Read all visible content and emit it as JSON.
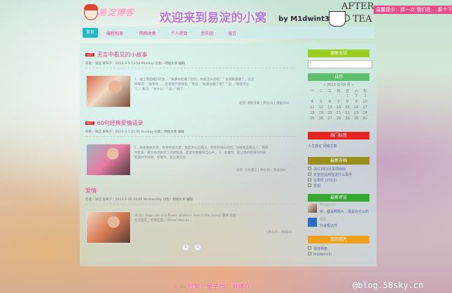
{
  "header": {
    "logo_text": "易淀博客",
    "site_title": "欢迎来到易淀的小窝",
    "site_author": "by M1dwint3r",
    "tea_top": "AFTER",
    "tea_bottom": "TEA",
    "marquee": "温馨提示：那一次 我们在… 那个下雨"
  },
  "nav": [
    {
      "label": "首页",
      "active": true
    },
    {
      "label": "编程相册"
    },
    {
      "label": "网络收集"
    },
    {
      "label": "个人项目"
    },
    {
      "label": "音乐园"
    },
    {
      "label": "留言"
    }
  ],
  "posts": [
    {
      "hot_label": "HOT",
      "title": "无言中看见的小故事",
      "meta": "作者：易淀 发布于：2013-3-9 13:54 Monday 分类：网络文章 编辑",
      "excerpt_line1": "1、碰上熟面相识的女... “如果你想看了他们，你会怎么办呢？” 女孩跟我聊了，说出",
      "excerpt_line2": "哪哪说：“如果你……后来我不想想说，” 我说：“如果你看了嗯？” 说：“那就可以",
      "excerpt_line3": "了。” 我问：“为什么？” 说：“嘛下...",
      "tags": "标签: 网络文章 | 评论(0) | 阅读(93)"
    },
    {
      "hot_label": "HOT",
      "title": "60句经典爱情语录",
      "meta": "作者：易淀 发布于：2013-3-1 21:01 Sunday 分类：网络文章 编辑",
      "excerpt_line1": "1、如果我离开你，你要很想念我，我是你以前遇过，所有的快乐的回，如果我是路过人，我要",
      "excerpt_line2": "你是爱，我为你把微笑了得相思满，就是你整着每当心中。         2、爱着你，就让我把寂寞的时候",
      "excerpt_line3": "有我并不好想，有着你，就让我在你...",
      "tags": "标签: 人生感言 | 评论(0) | 阅读(48)"
    },
    {
      "hot_label": "",
      "title": "爱情",
      "meta": "作者：易淀 发布于：2013-2-20 23:06 Wednesday 分类：网络文章 编辑",
      "excerpt_line1": "Victor Hugo        Life is a flower of which love is the honey.          雨果 雨果",
      "excerpt_line2": "生活是花，爱情是蜜。         Oliver Wende...",
      "excerpt_line3": "",
      "tags": "| 评论(0) | 阅读(0)"
    }
  ],
  "pager": [
    "1",
    "2"
  ],
  "sidebar": {
    "search_title": "搜索全站",
    "search_placeholder": "",
    "calendar_title": "日历",
    "calendar_header": "« 2013 年 03 月 »",
    "weekdays": [
      "一",
      "二",
      "三",
      "四",
      "五",
      "六",
      "日"
    ],
    "weeks": [
      [
        "",
        "",
        "",
        "",
        "1",
        "2",
        "3"
      ],
      [
        "4",
        "5",
        "6",
        "7",
        "8",
        "9",
        "10"
      ],
      [
        "11",
        "12",
        "13",
        "14",
        "15",
        "16",
        "17"
      ],
      [
        "18",
        "19",
        "20",
        "21",
        "22",
        "23",
        "24"
      ],
      [
        "25",
        "26",
        "27",
        "28",
        "29",
        "30",
        "31"
      ]
    ],
    "tags_title": "热门标签",
    "tags_text": "人生感言  网络文章",
    "archive_title": "最新存档",
    "archive": [
      "2013年3月事项存档",
      "无空还没到我说什么事件",
      "在零阶 (2013)",
      "爱情"
    ],
    "comments_title": "最新评论",
    "comments": [
      {
        "name": "M1dwint3r",
        "text": "哈，都是啊照片，很喜欢什么的"
      },
      {
        "name": "易淀",
        "text": "你说呢这样"
      }
    ],
    "links_title": "我的照片",
    "links": [
      "易淀相册",
      "M1dwint3r"
    ]
  },
  "footer": {
    "text": "短暂：是子怡，尹娜介",
    "small": "© 2013",
    "url": "@blog.58sky.cn"
  },
  "colors": {
    "nav_active": "#26b7c5",
    "post_title": "#e0478c",
    "search_title": "#9acd1e",
    "calendar_title": "#5ec06e",
    "tags_title": "#e62222",
    "archive_title": "#9a8f1c",
    "comments_title": "#35a82f",
    "links_title": "#f0a01a"
  }
}
